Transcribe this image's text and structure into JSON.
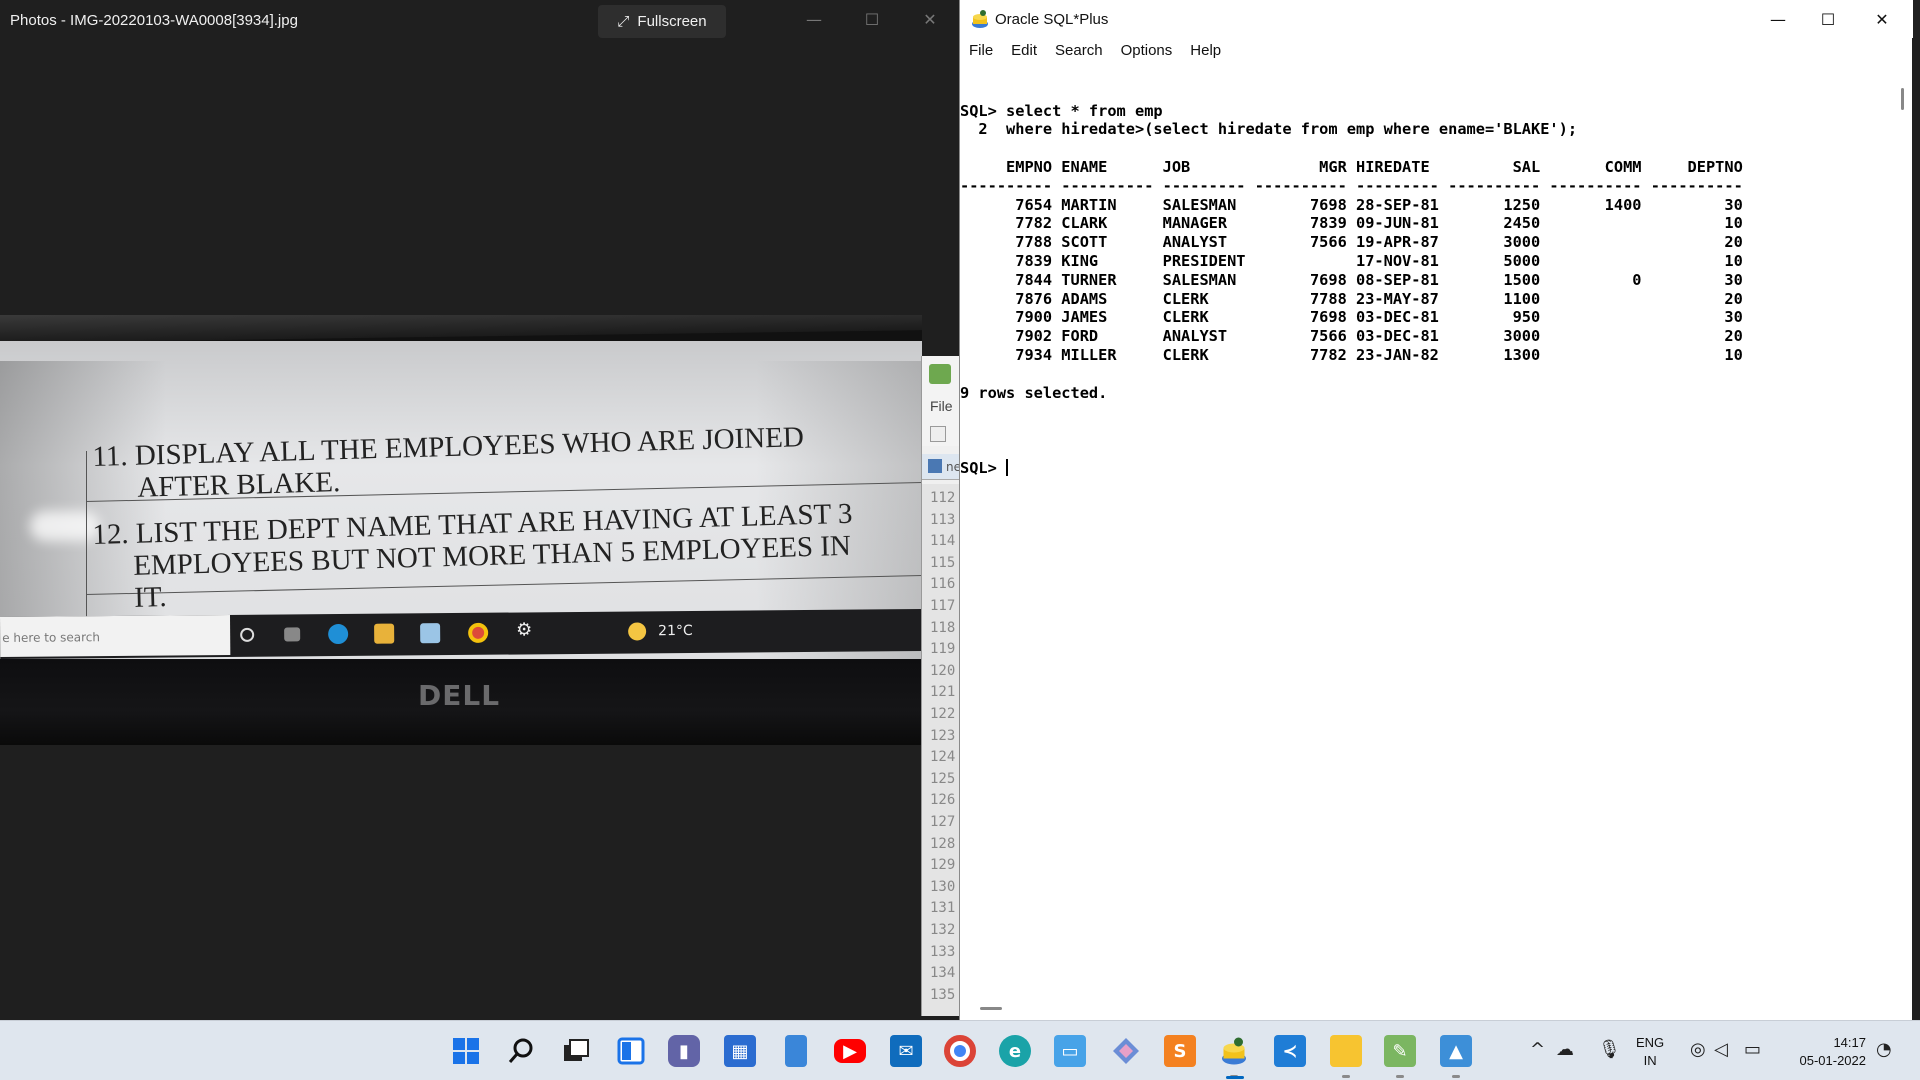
{
  "photos": {
    "title": "Photos - IMG-20220103-WA0008[3934].jpg",
    "fullscreen_label": "Fullscreen",
    "photo": {
      "q11": "11. DISPLAY ALL THE EMPLOYEES WHO ARE JOINED",
      "q11_cont": "AFTER BLAKE.",
      "q12": "12.  LIST THE DEPT NAME THAT ARE HAVING AT LEAST 3",
      "q12_cont": "EMPLOYEES BUT NOT MORE THAN 5 EMPLOYEES IN",
      "q12_cont2": "IT.",
      "search_text": "e here to search",
      "temperature": "21°C",
      "brand": "DELL"
    }
  },
  "notepad": {
    "file_label": "File",
    "tab_label": "ne",
    "line_numbers": [
      "112",
      "113",
      "114",
      "115",
      "116",
      "117",
      "118",
      "119",
      "120",
      "121",
      "122",
      "123",
      "124",
      "125",
      "126",
      "127",
      "128",
      "129",
      "130",
      "131",
      "132",
      "133",
      "134",
      "135"
    ]
  },
  "sqlplus": {
    "title": "Oracle SQL*Plus",
    "menu": [
      "File",
      "Edit",
      "Search",
      "Options",
      "Help"
    ],
    "console": [
      "SQL> select * from emp",
      "  2  where hiredate>(select hiredate from emp where ename='BLAKE');",
      "",
      "     EMPNO ENAME      JOB              MGR HIREDATE         SAL       COMM     DEPTNO",
      "---------- ---------- --------- ---------- --------- ---------- ---------- ----------",
      "      7654 MARTIN     SALESMAN        7698 28-SEP-81       1250       1400         30",
      "      7782 CLARK      MANAGER         7839 09-JUN-81       2450                    10",
      "      7788 SCOTT      ANALYST         7566 19-APR-87       3000                    20",
      "      7839 KING       PRESIDENT            17-NOV-81       5000                    10",
      "      7844 TURNER     SALESMAN        7698 08-SEP-81       1500          0         30",
      "      7876 ADAMS      CLERK           7788 23-MAY-87       1100                    20",
      "      7900 JAMES      CLERK           7698 03-DEC-81        950                    30",
      "      7902 FORD       ANALYST         7566 03-DEC-81       3000                    20",
      "      7934 MILLER     CLERK           7782 23-JAN-82       1300                    10",
      "",
      "9 rows selected.",
      ""
    ],
    "prompt": "SQL> "
  },
  "taskbar": {
    "apps": [
      "start-icon",
      "search-icon",
      "task-view-icon",
      "widgets-icon",
      "teams-chat-icon",
      "store-icon",
      "phone-icon",
      "youtube-icon",
      "mail-icon",
      "chrome-icon",
      "edge-icon",
      "remote-desktop-icon",
      "gitkraken-icon",
      "sublime-icon",
      "sqlplus-icon",
      "vscode-icon",
      "file-explorer-icon",
      "notepadpp-icon",
      "photos-icon"
    ],
    "lang_top": "ENG",
    "lang_bottom": "IN",
    "time": "14:17",
    "date": "05-01-2022"
  }
}
